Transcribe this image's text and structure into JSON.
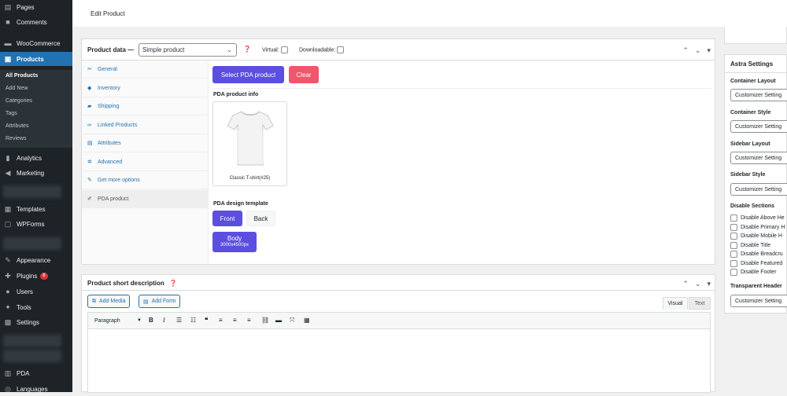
{
  "sidebar": {
    "items_top": [
      {
        "label": "Pages",
        "icon": "pages-icon"
      },
      {
        "label": "Comments",
        "icon": "comments-icon"
      },
      {
        "label": "WooCommerce",
        "icon": "woocommerce-icon"
      },
      {
        "label": "Products",
        "icon": "products-icon"
      }
    ],
    "submenu": [
      "All Products",
      "Add New",
      "Categories",
      "Tags",
      "Attributes",
      "Reviews"
    ],
    "items_mid": [
      {
        "label": "Analytics",
        "icon": "analytics-icon"
      },
      {
        "label": "Marketing",
        "icon": "marketing-icon"
      }
    ],
    "items_low": [
      {
        "label": "Templates",
        "icon": "templates-icon"
      },
      {
        "label": "WPForms",
        "icon": "wpforms-icon"
      }
    ],
    "items_bottom": [
      {
        "label": "Appearance",
        "icon": "appearance-icon"
      },
      {
        "label": "Plugins",
        "icon": "plugins-icon",
        "badge": "8"
      },
      {
        "label": "Users",
        "icon": "users-icon"
      },
      {
        "label": "Tools",
        "icon": "tools-icon"
      },
      {
        "label": "Settings",
        "icon": "settings-icon"
      }
    ],
    "items_end": [
      {
        "label": "PDA",
        "icon": "pda-icon"
      },
      {
        "label": "Languages",
        "icon": "languages-icon"
      }
    ]
  },
  "header": {
    "title": "Edit Product"
  },
  "product_data": {
    "label": "Product data —",
    "type_value": "Simple product",
    "virtual_label": "Virtual:",
    "downloadable_label": "Downloadable:",
    "tabs": [
      {
        "label": "General",
        "icon": "wrench-icon"
      },
      {
        "label": "Inventory",
        "icon": "tag-icon"
      },
      {
        "label": "Shipping",
        "icon": "truck-icon"
      },
      {
        "label": "Linked Products",
        "icon": "link-icon"
      },
      {
        "label": "Attributes",
        "icon": "list-icon"
      },
      {
        "label": "Advanced",
        "icon": "gear-icon"
      },
      {
        "label": "Get more options",
        "icon": "plug-icon"
      },
      {
        "label": "PDA product",
        "icon": "brush-icon"
      }
    ],
    "select_pda_label": "Select PDA product",
    "clear_label": "Clear",
    "pda_info_title": "PDA product info",
    "product_caption": "Classic T-shirt(#25)",
    "design_template_title": "PDA design template",
    "front_label": "Front",
    "back_label": "Back",
    "body_label": "Body",
    "body_size": "3000x4500px"
  },
  "short_desc": {
    "title": "Product short description",
    "add_media": "Add Media",
    "add_form": "Add Form",
    "visual_tab": "Visual",
    "text_tab": "Text",
    "format_value": "Paragraph"
  },
  "astra": {
    "title": "Astra Settings",
    "container_layout_label": "Container Layout",
    "container_layout_value": "Customizer Setting",
    "container_style_label": "Container Style",
    "container_style_value": "Customizer Setting",
    "sidebar_layout_label": "Sidebar Layout",
    "sidebar_layout_value": "Customizer Setting",
    "sidebar_style_label": "Sidebar Style",
    "sidebar_style_value": "Customizer Setting",
    "disable_sections_label": "Disable Sections",
    "disable_items": [
      "Disable Above He",
      "Disable Primary H",
      "Disable Mobile H",
      "Disable Title",
      "Disable Breadcru",
      "Disable Featured",
      "Disable Footer"
    ],
    "transparent_header_label": "Transparent Header",
    "transparent_header_value": "Customizer Setting"
  },
  "colors": {
    "accent": "#2271b1",
    "purple": "#5b4ee0",
    "danger": "#f0566c",
    "admin_bg": "#1d2327"
  }
}
